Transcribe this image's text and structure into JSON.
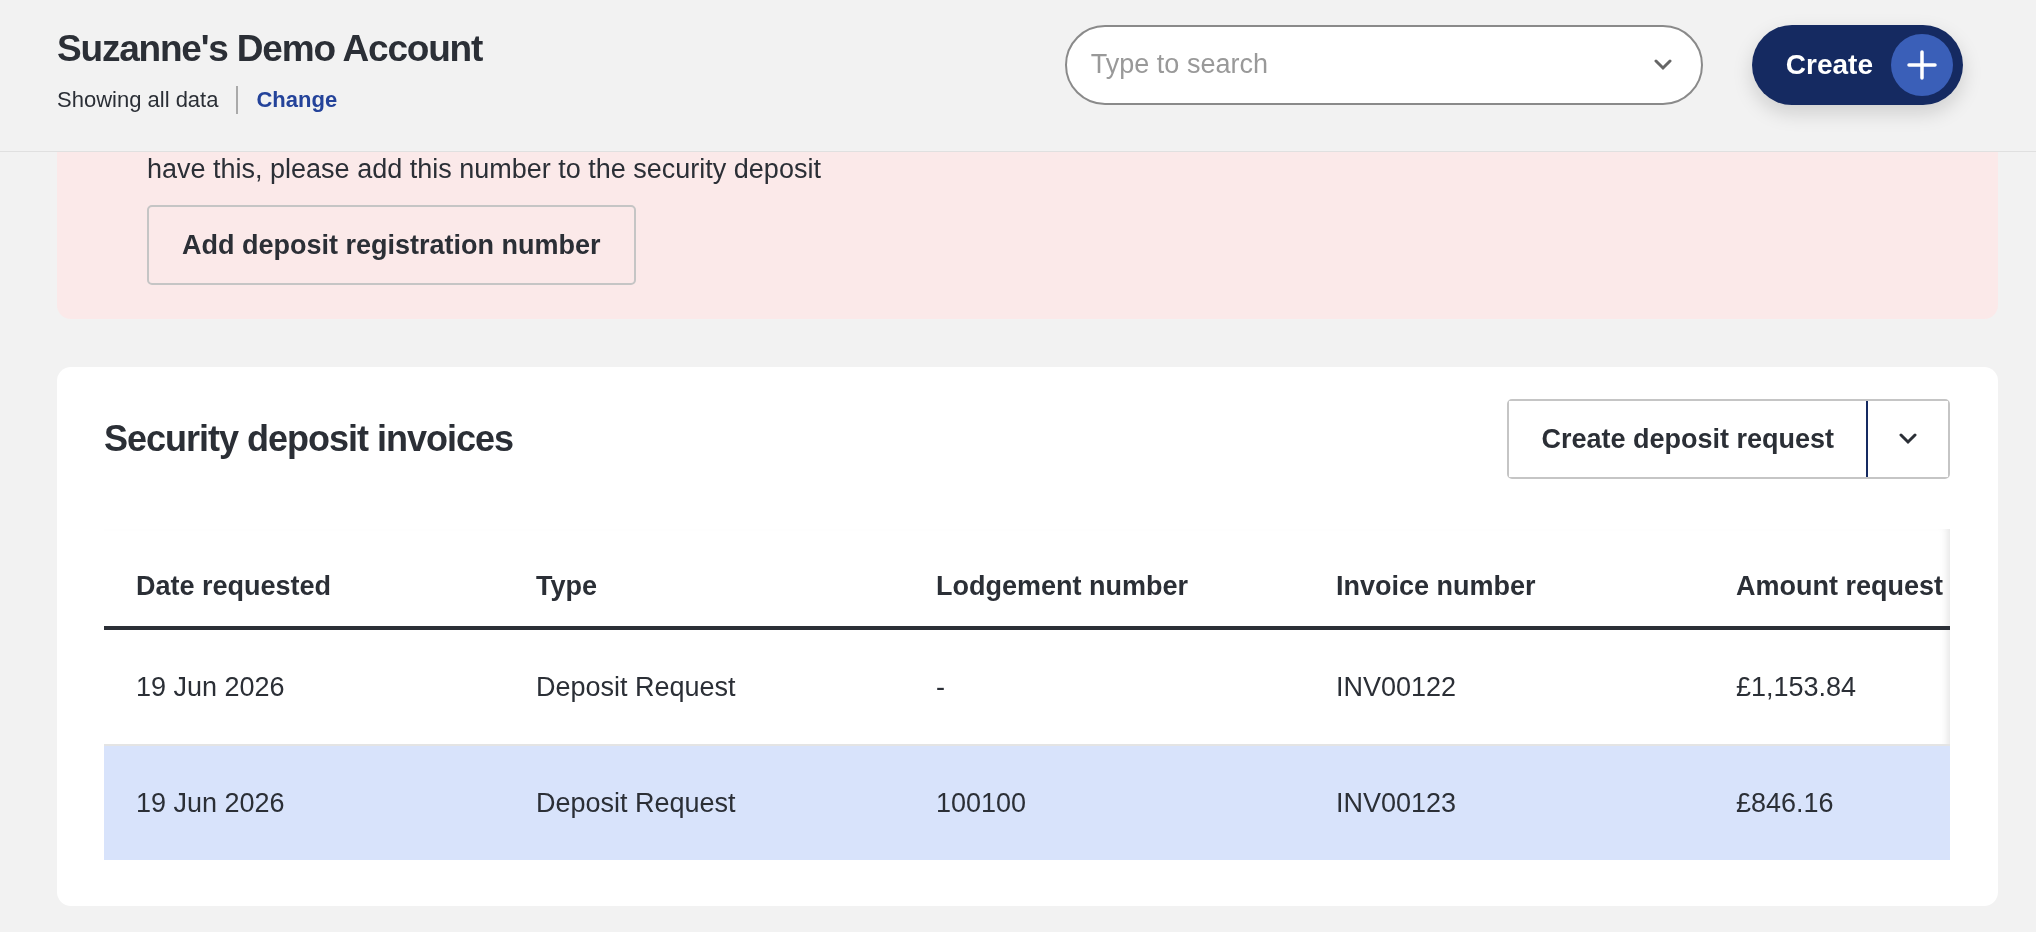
{
  "header": {
    "account_name": "Suzanne's Demo Account",
    "scope": "Showing all data",
    "change_link": "Change",
    "search": {
      "placeholder": "Type to search"
    },
    "create_button": "Create"
  },
  "alert": {
    "message": "have this, please add this number to the security deposit",
    "button": "Add deposit registration number"
  },
  "invoices": {
    "title": "Security deposit invoices",
    "action_button": "Create deposit request",
    "table": {
      "columns": [
        "Date requested",
        "Type",
        "Lodgement number",
        "Invoice number",
        "Amount request"
      ],
      "rows": [
        {
          "selected": false,
          "cells": [
            "19 Jun 2026",
            "Deposit Request",
            "-",
            "INV00122",
            "£1,153.84"
          ]
        },
        {
          "selected": true,
          "cells": [
            "19 Jun 2026",
            "Deposit Request",
            "100100",
            "INV00123",
            "£846.16"
          ]
        }
      ]
    }
  }
}
